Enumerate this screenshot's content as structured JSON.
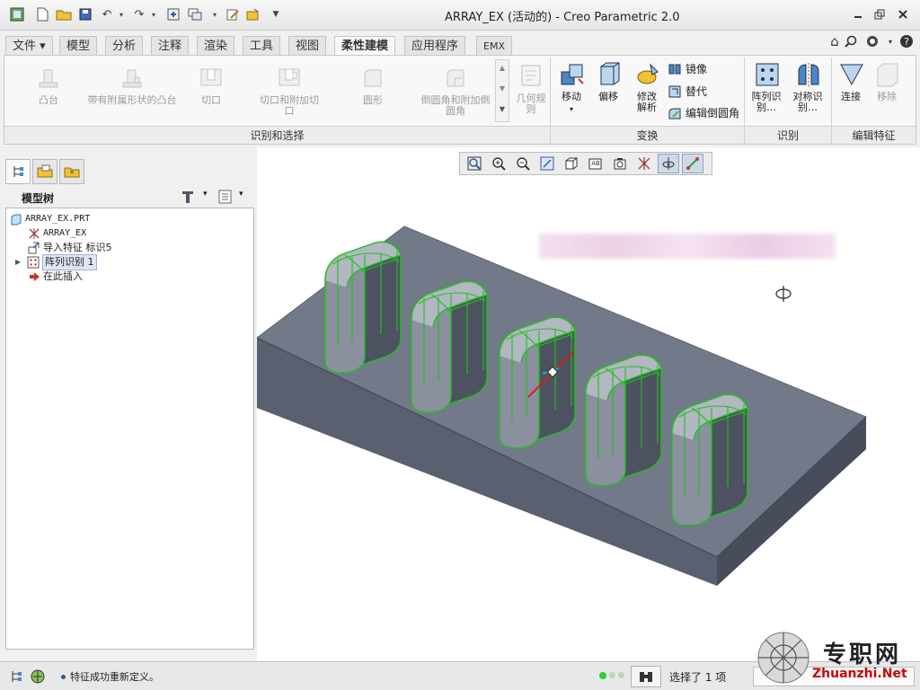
{
  "window": {
    "title": "ARRAY_EX (活动的) - Creo Parametric 2.0"
  },
  "menu_tabs": [
    {
      "label": "文件 ▾"
    },
    {
      "label": "模型"
    },
    {
      "label": "分析"
    },
    {
      "label": "注释"
    },
    {
      "label": "渲染"
    },
    {
      "label": "工具"
    },
    {
      "label": "视图"
    },
    {
      "label": "柔性建模",
      "active": true
    },
    {
      "label": "应用程序"
    },
    {
      "label": "EMX"
    }
  ],
  "ribbon": {
    "identify": {
      "group_label": "识别和选择",
      "buttons": [
        {
          "label": "凸台"
        },
        {
          "label": "带有附属形状的凸台"
        },
        {
          "label": "切口"
        },
        {
          "label": "切口和附加切口"
        },
        {
          "label": "圆形"
        },
        {
          "label": "倒圆角和附加倒圆角"
        }
      ],
      "geometry_rule": "几何规则"
    },
    "transform": {
      "group_label": "变换",
      "move": "移动",
      "offset": "偏移",
      "modify_analyze": "修改解析",
      "mirror": "镜像",
      "substitute": "替代",
      "edit_round": "编辑倒圆角"
    },
    "recognize": {
      "group_label": "识别",
      "pattern_recognize": "阵列识别…",
      "symmetry_recognize": "对称识别…"
    },
    "edit_feature": {
      "group_label": "编辑特征",
      "attach": "连接",
      "remove": "移除"
    }
  },
  "model_tree": {
    "title": "模型树",
    "nodes": [
      {
        "label": "ARRAY_EX.PRT"
      },
      {
        "label": "ARRAY_EX"
      },
      {
        "label": "导入特征 标识5"
      },
      {
        "label": "阵列识别 1",
        "selected": true
      },
      {
        "label": "在此插入"
      }
    ]
  },
  "status": {
    "message": "特征成功重新定义。",
    "selected": "选择了 1 项"
  },
  "watermark": {
    "text": "专职网",
    "url": "Zhuanzhi.Net"
  },
  "colors": {
    "accent": "#2a5aa8",
    "highlight_green": "#22c020",
    "model_gray": "#6f7685"
  }
}
